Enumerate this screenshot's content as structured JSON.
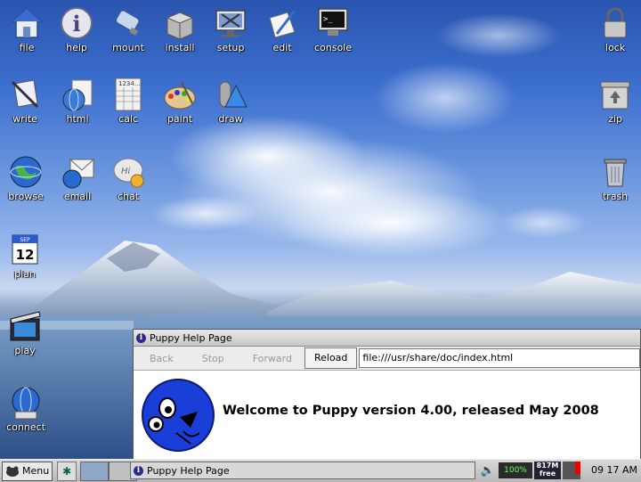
{
  "desktop": {
    "icons": [
      {
        "id": "file",
        "label": "file"
      },
      {
        "id": "help",
        "label": "help"
      },
      {
        "id": "mount",
        "label": "mount"
      },
      {
        "id": "install",
        "label": "install"
      },
      {
        "id": "setup",
        "label": "setup"
      },
      {
        "id": "edit",
        "label": "edit"
      },
      {
        "id": "console",
        "label": "console"
      },
      {
        "id": "lock",
        "label": "lock"
      },
      {
        "id": "write",
        "label": "write"
      },
      {
        "id": "html",
        "label": "html"
      },
      {
        "id": "calc",
        "label": "calc"
      },
      {
        "id": "paint",
        "label": "paint"
      },
      {
        "id": "draw",
        "label": "draw"
      },
      {
        "id": "zip",
        "label": "zip"
      },
      {
        "id": "browse",
        "label": "browse"
      },
      {
        "id": "email",
        "label": "email"
      },
      {
        "id": "chat",
        "label": "chat"
      },
      {
        "id": "trash",
        "label": "trash"
      },
      {
        "id": "plan",
        "label": "plan"
      },
      {
        "id": "play",
        "label": "play"
      },
      {
        "id": "connect",
        "label": "connect"
      }
    ],
    "calendar_day": "12",
    "calendar_month": "SEP",
    "calc_digits": "1234..."
  },
  "browser": {
    "title": "Puppy Help Page",
    "back": "Back",
    "stop": "Stop",
    "forward": "Forward",
    "reload": "Reload",
    "url": "file:///usr/share/doc/index.html",
    "welcome": "Welcome to Puppy version 4.00, released May 2008"
  },
  "taskbar": {
    "menu_label": "Menu",
    "task_label": "Puppy Help Page",
    "battery_text": "100%",
    "mem_top": "817M",
    "mem_bottom": "free",
    "clock": "09 17 AM"
  },
  "colors": {
    "sky_top": "#2a55b0",
    "lake": "#3a5f98",
    "puppy_blue": "#1a3fd8",
    "taskbar": "#c8c8c8"
  }
}
